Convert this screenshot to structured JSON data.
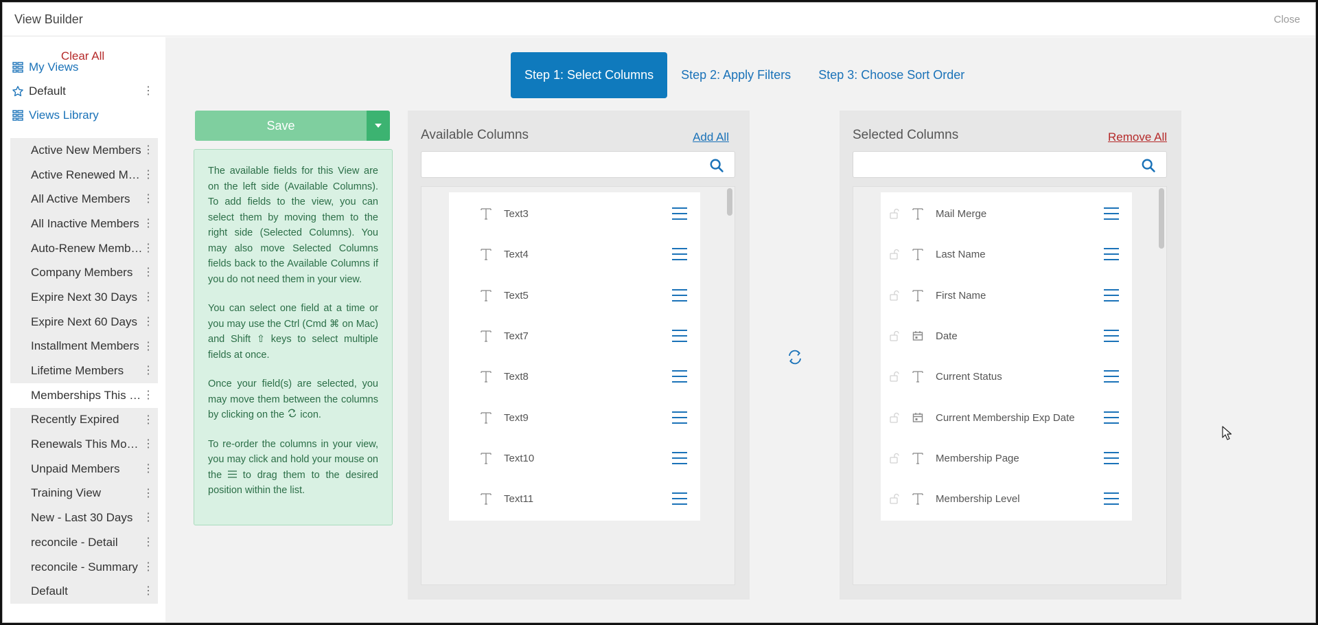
{
  "window": {
    "title": "View Builder",
    "close_label": "Close"
  },
  "sidebar": {
    "clear_all": "Clear All",
    "my_views": "My Views",
    "default_view": "Default",
    "views_library": "Views Library",
    "library_items": [
      "Active New Members",
      "Active Renewed Members",
      "All Active Members",
      "All Inactive Members",
      "Auto-Renew Members",
      "Company Members",
      "Expire Next 30 Days",
      "Expire Next 60 Days",
      "Installment Members",
      "Lifetime Members",
      "Memberships This Month",
      "Recently Expired",
      "Renewals This Month",
      "Unpaid Members",
      "Training View",
      "New - Last 30 Days",
      "reconcile - Detail",
      "reconcile - Summary",
      "Default"
    ],
    "active_index": 10
  },
  "steps": {
    "step1": "Step 1: Select Columns",
    "step2": "Step 2: Apply Filters",
    "step3": "Step 3: Choose Sort Order"
  },
  "save": {
    "label": "Save"
  },
  "help": {
    "p1": "The available fields for this View are on the left side (Available Columns). To add fields to the view, you can select them by moving them to the right side (Selected Columns). You may also move Selected Columns fields back to the Available Columns if you do not need them in your view.",
    "p2": "You can select one field at a time or you may use the Ctrl (Cmd ⌘ on Mac) and Shift ⇧ keys to select multiple fields at once.",
    "p3a": "Once your field(s) are selected, you may move them between the columns by clicking on the",
    "p3b": "icon.",
    "p4a": "To re-order the columns in your view, you may click and hold your mouse on the",
    "p4b": "to drag them to the desired position within the list."
  },
  "available": {
    "title": "Available Columns",
    "action": "Add All",
    "items": [
      {
        "label": "Text3",
        "type": "text"
      },
      {
        "label": "Text4",
        "type": "text"
      },
      {
        "label": "Text5",
        "type": "text"
      },
      {
        "label": "Text7",
        "type": "text"
      },
      {
        "label": "Text8",
        "type": "text"
      },
      {
        "label": "Text9",
        "type": "text"
      },
      {
        "label": "Text10",
        "type": "text"
      },
      {
        "label": "Text11",
        "type": "text"
      }
    ]
  },
  "selected": {
    "title": "Selected Columns",
    "action": "Remove All",
    "items": [
      {
        "label": "Mail Merge",
        "type": "text"
      },
      {
        "label": "Last Name",
        "type": "text"
      },
      {
        "label": "First Name",
        "type": "text"
      },
      {
        "label": "Date",
        "type": "date"
      },
      {
        "label": "Current Status",
        "type": "text"
      },
      {
        "label": "Current Membership Exp Date",
        "type": "date"
      },
      {
        "label": "Membership Page",
        "type": "text"
      },
      {
        "label": "Membership Level",
        "type": "text"
      }
    ]
  },
  "colors": {
    "link": "#1a72b8",
    "danger": "#b52a2a",
    "step_active": "#0f7abd",
    "save": "#7fcf9f",
    "save_dropdown": "#3cb371",
    "help_bg": "#d9f1e3",
    "help_text": "#2b6e47"
  }
}
